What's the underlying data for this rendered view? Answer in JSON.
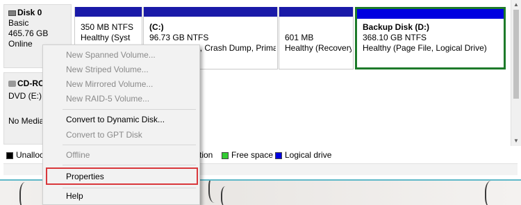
{
  "disks": [
    {
      "name": "Disk 0",
      "type": "Basic",
      "size": "465.76 GB",
      "status": "Online"
    },
    {
      "name": "CD-ROM",
      "type": "DVD (E:)",
      "status": "No Media"
    }
  ],
  "partitions": [
    {
      "label": "",
      "size": "350 MB NTFS",
      "status": "Healthy (Syst"
    },
    {
      "label": "(C:)",
      "size": "96.73 GB NTFS",
      "status": "Healthy (Boot, Crash Dump, Prima"
    },
    {
      "label": "",
      "size": "601 MB",
      "status": "Healthy (Recovery"
    },
    {
      "label": "Backup Disk  (D:)",
      "size": "368.10 GB NTFS",
      "status": "Healthy (Page File, Logical Drive)"
    }
  ],
  "legend": [
    {
      "label": "Unallocated",
      "color": "#000000"
    },
    {
      "label": "Primary partition",
      "color": "#1a1aa8"
    },
    {
      "label": "Free space",
      "color": "#33cc33"
    },
    {
      "label": "Logical drive",
      "color": "#0000e0"
    }
  ],
  "context_menu": {
    "new_spanned": "New Spanned Volume...",
    "new_striped": "New Striped Volume...",
    "new_mirrored": "New Mirrored Volume...",
    "new_raid5": "New RAID-5 Volume...",
    "convert_dynamic": "Convert to Dynamic Disk...",
    "convert_gpt": "Convert to GPT Disk",
    "offline": "Offline",
    "properties": "Properties",
    "help": "Help"
  },
  "colors": {
    "selection_border": "#1d7a2a",
    "highlight_box": "#d9373b"
  }
}
